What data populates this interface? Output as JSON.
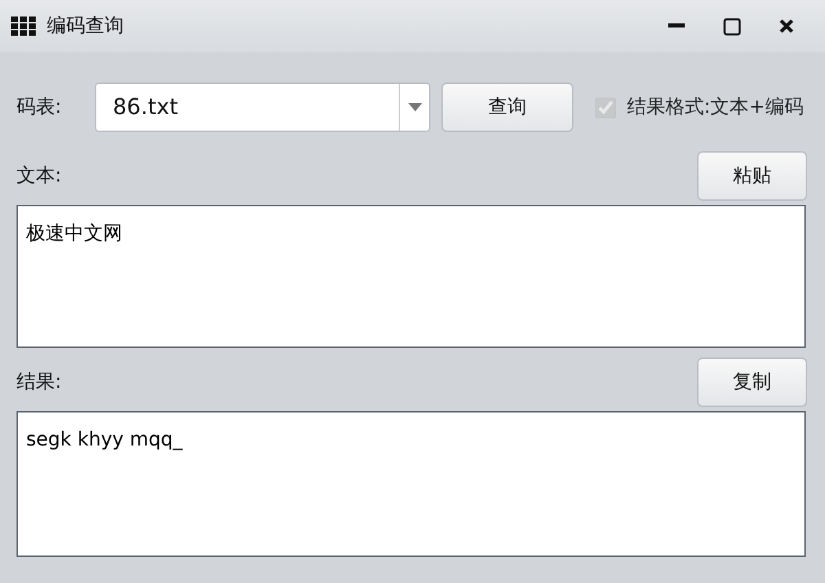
{
  "window": {
    "title": "编码查询"
  },
  "code_table": {
    "label": "码表:",
    "value": "86.txt"
  },
  "query_button": "查询",
  "format_option": {
    "label": "结果格式:文本+编码",
    "checked": true,
    "disabled": true
  },
  "text_section": {
    "label": "文本:",
    "button": "粘贴",
    "value": "极速中文网"
  },
  "result_section": {
    "label": "结果:",
    "button": "复制",
    "value": "segk khyy mqq_"
  }
}
